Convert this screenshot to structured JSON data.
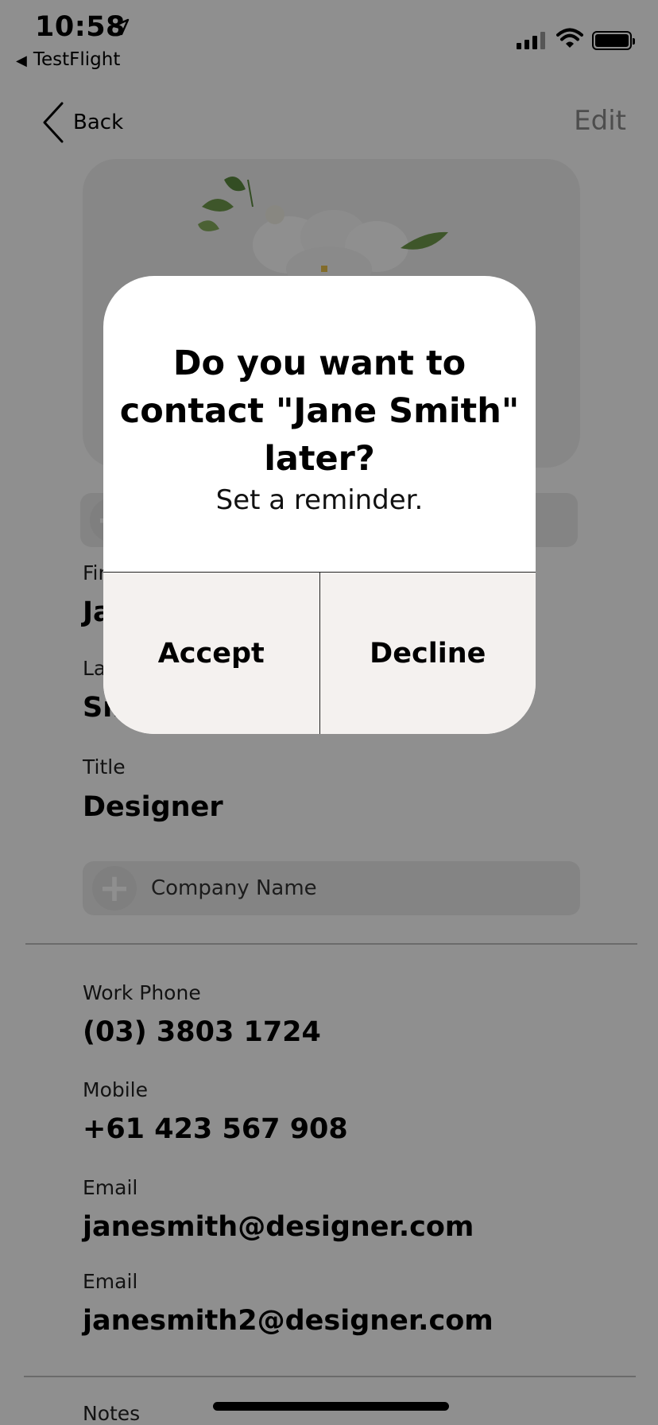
{
  "status_bar": {
    "time": "10:58",
    "back_app": "TestFlight"
  },
  "nav": {
    "back_label": "Back",
    "edit_label": "Edit"
  },
  "top_add_bar": {
    "label": ""
  },
  "fields": {
    "first_name": {
      "label": "First Name",
      "value": "Jane"
    },
    "last_name": {
      "label": "Last Name",
      "value": "Smith"
    },
    "title": {
      "label": "Title",
      "value": "Designer"
    },
    "company": {
      "placeholder": "Company Name"
    },
    "work_phone": {
      "label": "Work Phone",
      "value": "(03) 3803 1724"
    },
    "mobile": {
      "label": "Mobile",
      "value": "+61 423 567 908"
    },
    "email1": {
      "label": "Email",
      "value": "janesmith@designer.com"
    },
    "email2": {
      "label": "Email",
      "value": "janesmith2@designer.com"
    },
    "notes": {
      "label": "Notes"
    }
  },
  "alert": {
    "title": "Do you want to contact \"Jane Smith\" later?",
    "message": "Set a reminder.",
    "accept_label": "Accept",
    "decline_label": "Decline"
  },
  "colors": {
    "overlay": "#000000",
    "alert_bg": "#ffffff",
    "alert_actions_bg": "#f4f1ef",
    "edit_text": "#8a8a8a"
  }
}
